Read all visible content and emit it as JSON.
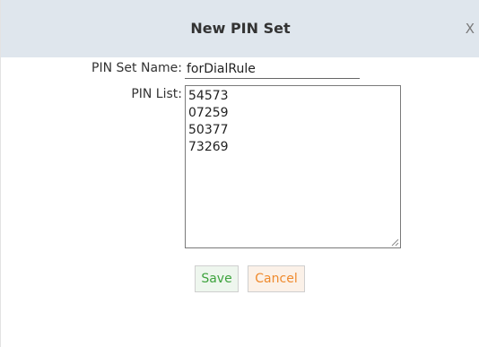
{
  "dialog": {
    "title": "New PIN Set",
    "close_label": "X"
  },
  "form": {
    "pin_set_name_label": "PIN Set Name:",
    "pin_set_name_value": "forDialRule",
    "pin_list_label": "PIN List:",
    "pin_list_value": "54573\n07259\n50377\n73269"
  },
  "buttons": {
    "save_label": "Save",
    "cancel_label": "Cancel"
  },
  "colors": {
    "titlebar_bg": "#dfe6ed",
    "save_text": "#3ea33e",
    "cancel_text": "#ef8a2d"
  }
}
